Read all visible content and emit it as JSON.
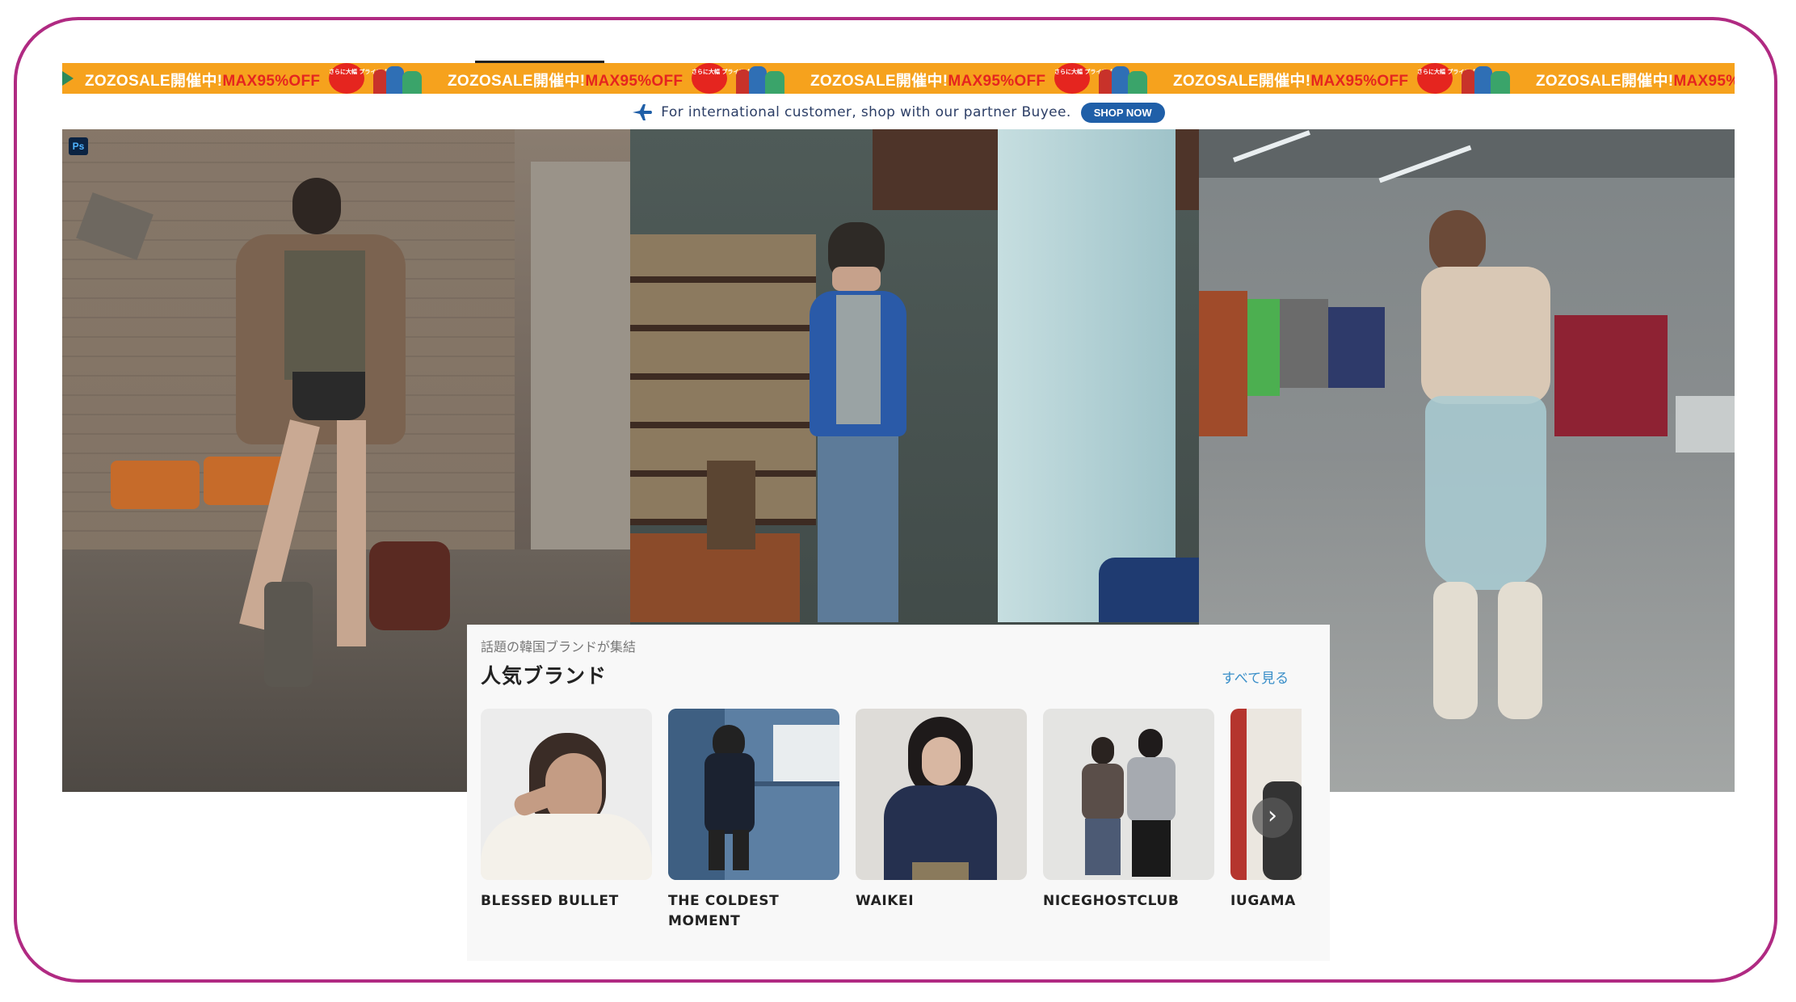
{
  "promo": {
    "text_main": "ZOZOSALE開催中!",
    "text_highlight": "MAX95%OFF",
    "badge_text": "さらに大幅 プライス ダウン",
    "colors": {
      "background": "#f6a21d",
      "highlight": "#e5251f"
    }
  },
  "intl": {
    "text": "For international customer, shop with our partner Buyee.",
    "button_label": "SHOP NOW",
    "icon": "airplane-icon"
  },
  "hero": {
    "badge": "Ps"
  },
  "brands": {
    "subtitle": "話題の韓国ブランドが集結",
    "title": "人気ブランド",
    "see_all": "すべて見る",
    "items": [
      {
        "name": "BLESSED BULLET"
      },
      {
        "name": "THE COLDEST MOMENT"
      },
      {
        "name": "WAIKEI"
      },
      {
        "name": "NICEGHOSTCLUB"
      },
      {
        "name": "IUGAMA"
      }
    ],
    "next_icon": "chevron-right-icon"
  }
}
